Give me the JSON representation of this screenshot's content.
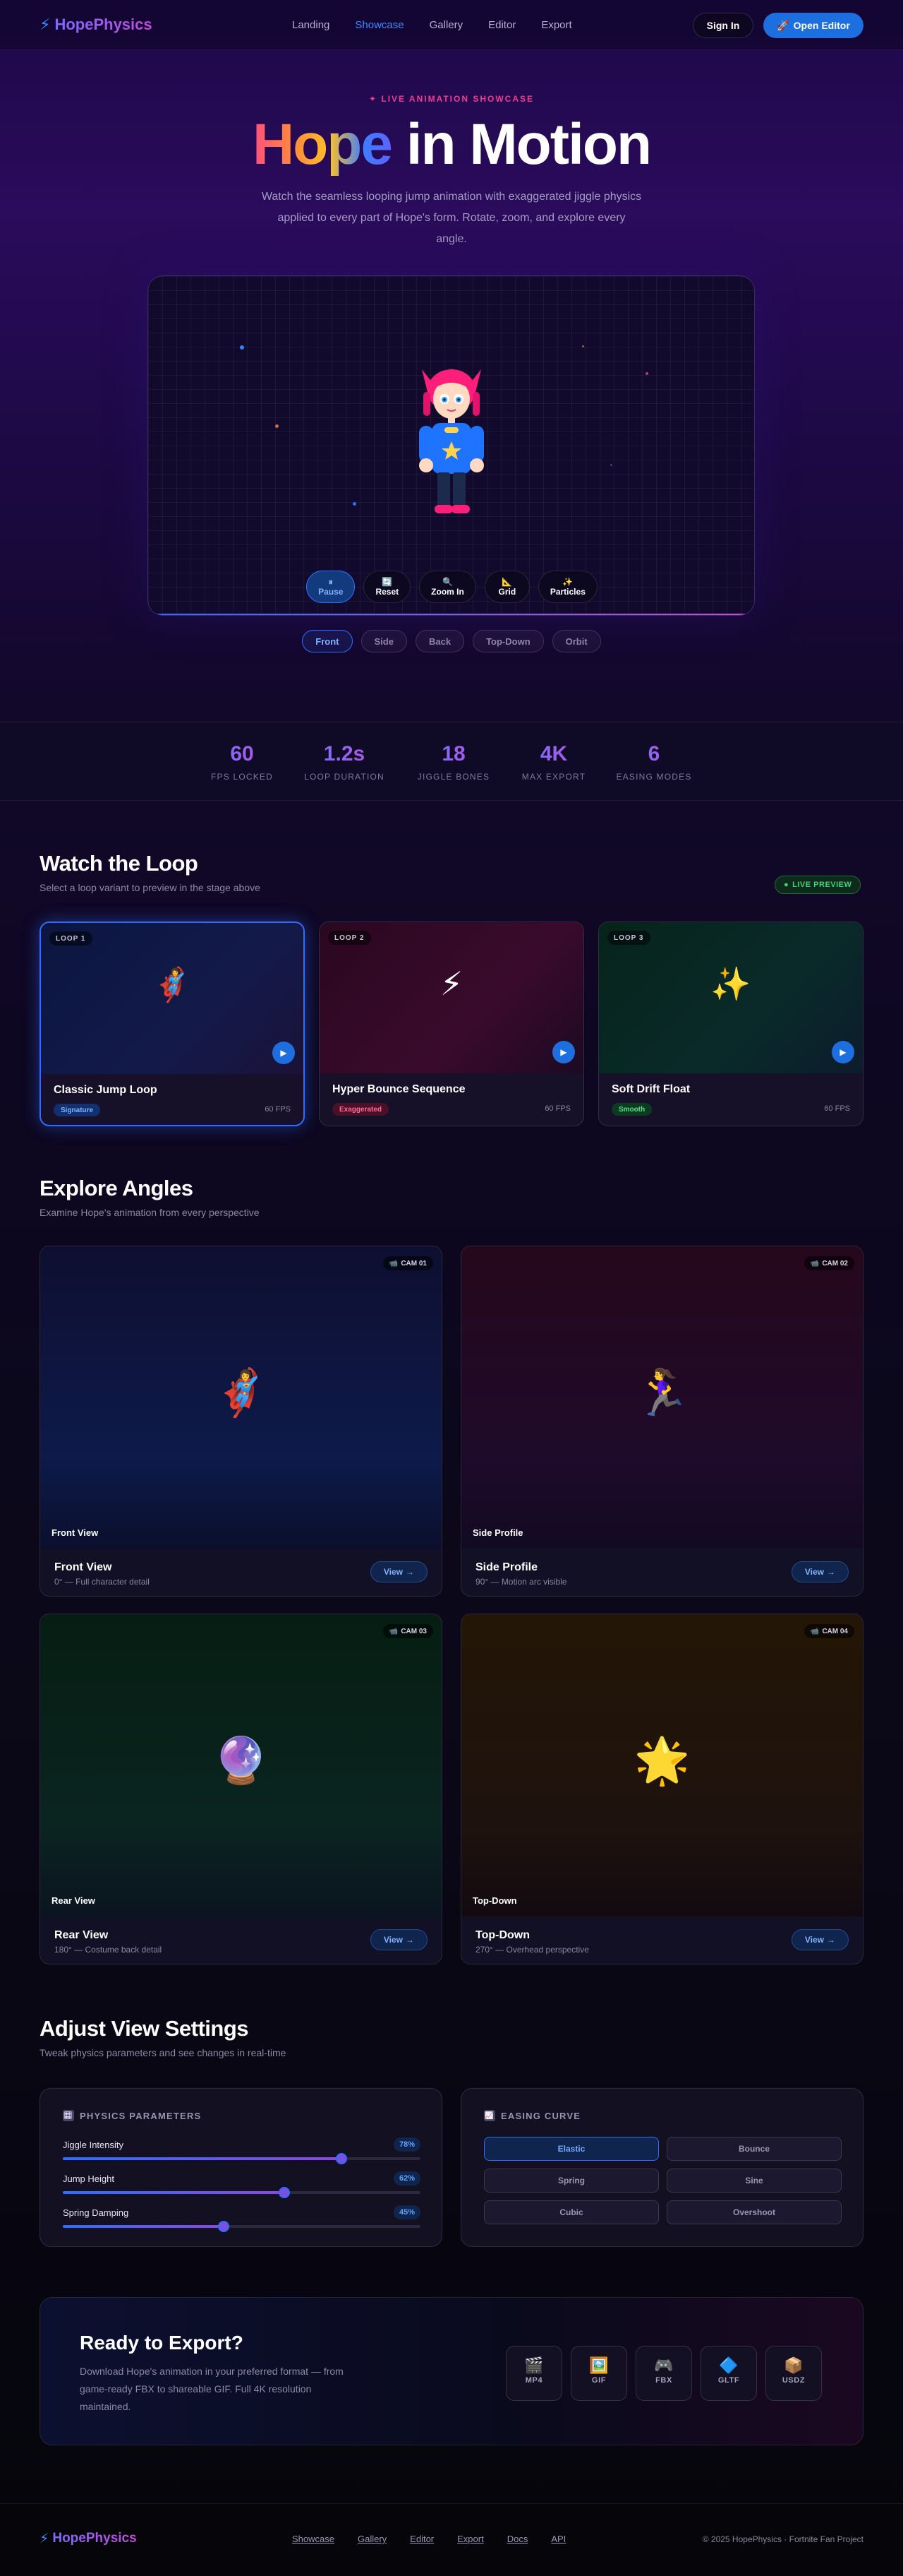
{
  "nav": {
    "logo": "HopePhysics",
    "links": [
      "Landing",
      "Showcase",
      "Gallery",
      "Editor",
      "Export"
    ],
    "active": "Showcase",
    "signin": "Sign In",
    "editor": "Open Editor"
  },
  "hero": {
    "eyebrow": "✦ LIVE ANIMATION SHOWCASE",
    "title_grad": "Hope",
    "title_rest": " in Motion",
    "subtitle": "Watch the seamless looping jump animation with exaggerated jiggle physics applied to every part of Hope's form. Rotate, zoom, and explore every angle.",
    "controls": [
      {
        "icon": "⏸",
        "label": "Pause",
        "active": true
      },
      {
        "icon": "🔄",
        "label": "Reset",
        "active": false
      },
      {
        "icon": "🔍",
        "label": "Zoom In",
        "active": false
      },
      {
        "icon": "📐",
        "label": "Grid",
        "active": false
      },
      {
        "icon": "✨",
        "label": "Particles",
        "active": false
      }
    ],
    "angle_tabs": [
      "Front",
      "Side",
      "Back",
      "Top-Down",
      "Orbit"
    ],
    "active_angle": "Front"
  },
  "stats": [
    {
      "value": "60",
      "label": "FPS LOCKED"
    },
    {
      "value": "1.2s",
      "label": "LOOP DURATION"
    },
    {
      "value": "18",
      "label": "JIGGLE BONES"
    },
    {
      "value": "4K",
      "label": "MAX EXPORT"
    },
    {
      "value": "6",
      "label": "EASING MODES"
    }
  ],
  "loops": {
    "title": "Watch the Loop",
    "subtitle": "Select a loop variant to preview in the stage above",
    "live": "LIVE PREVIEW",
    "cards": [
      {
        "tag": "LOOP 1",
        "emoji": "🦸‍♀️",
        "title": "Classic Jump Loop",
        "badge": "Signature",
        "badge_color": "#2f6dff",
        "fps": "60 FPS"
      },
      {
        "tag": "LOOP 2",
        "emoji": "⚡",
        "title": "Hyper Bounce Sequence",
        "badge": "Exaggerated",
        "badge_color": "#e2457e",
        "fps": "60 FPS"
      },
      {
        "tag": "LOOP 3",
        "emoji": "✨",
        "title": "Soft Drift Float",
        "badge": "Smooth",
        "badge_color": "#3fd37a",
        "fps": "60 FPS"
      }
    ]
  },
  "angles": {
    "title": "Explore Angles",
    "subtitle": "Examine Hope's animation from every perspective",
    "cards": [
      {
        "cam": "CAM 01",
        "emoji": "🦸‍♀️",
        "overlay": "Front View",
        "name": "Front View",
        "desc": "0° — Full character detail",
        "btn": "View"
      },
      {
        "cam": "CAM 02",
        "emoji": "🏃‍♀️",
        "overlay": "Side Profile",
        "name": "Side Profile",
        "desc": "90° — Motion arc visible",
        "btn": "View"
      },
      {
        "cam": "CAM 03",
        "emoji": "🔮",
        "overlay": "Rear View",
        "name": "Rear View",
        "desc": "180° — Costume back detail",
        "btn": "View"
      },
      {
        "cam": "CAM 04",
        "emoji": "🌟",
        "overlay": "Top-Down",
        "name": "Top-Down",
        "desc": "270° — Overhead perspective",
        "btn": "View"
      }
    ]
  },
  "settings": {
    "title": "Adjust View Settings",
    "subtitle": "Tweak physics parameters and see changes in real-time",
    "physics_title": "PHYSICS PARAMETERS",
    "sliders": [
      {
        "label": "Jiggle Intensity",
        "value": "78%",
        "level": 0.78
      },
      {
        "label": "Jump Height",
        "value": "62%",
        "level": 0.62
      },
      {
        "label": "Spring Damping",
        "value": "45%",
        "level": 0.45
      }
    ],
    "easing_title": "EASING CURVE",
    "easing": [
      "Elastic",
      "Bounce",
      "Spring",
      "Sine",
      "Cubic",
      "Overshoot"
    ],
    "easing_active": "Elastic"
  },
  "export": {
    "title": "Ready to Export?",
    "desc": "Download Hope's animation in your preferred format — from game-ready FBX to shareable GIF. Full 4K resolution maintained.",
    "formats": [
      {
        "icon": "🎬",
        "name": "MP4"
      },
      {
        "icon": "🖼️",
        "name": "GIF"
      },
      {
        "icon": "🎮",
        "name": "FBX"
      },
      {
        "icon": "🔷",
        "name": "GLTF"
      },
      {
        "icon": "📦",
        "name": "USDZ"
      }
    ]
  },
  "footer": {
    "logo": "HopePhysics",
    "links": [
      "Showcase",
      "Gallery",
      "Editor",
      "Export",
      "Docs",
      "API"
    ],
    "copyright": "© 2025 HopePhysics · Fortnite Fan Project"
  }
}
